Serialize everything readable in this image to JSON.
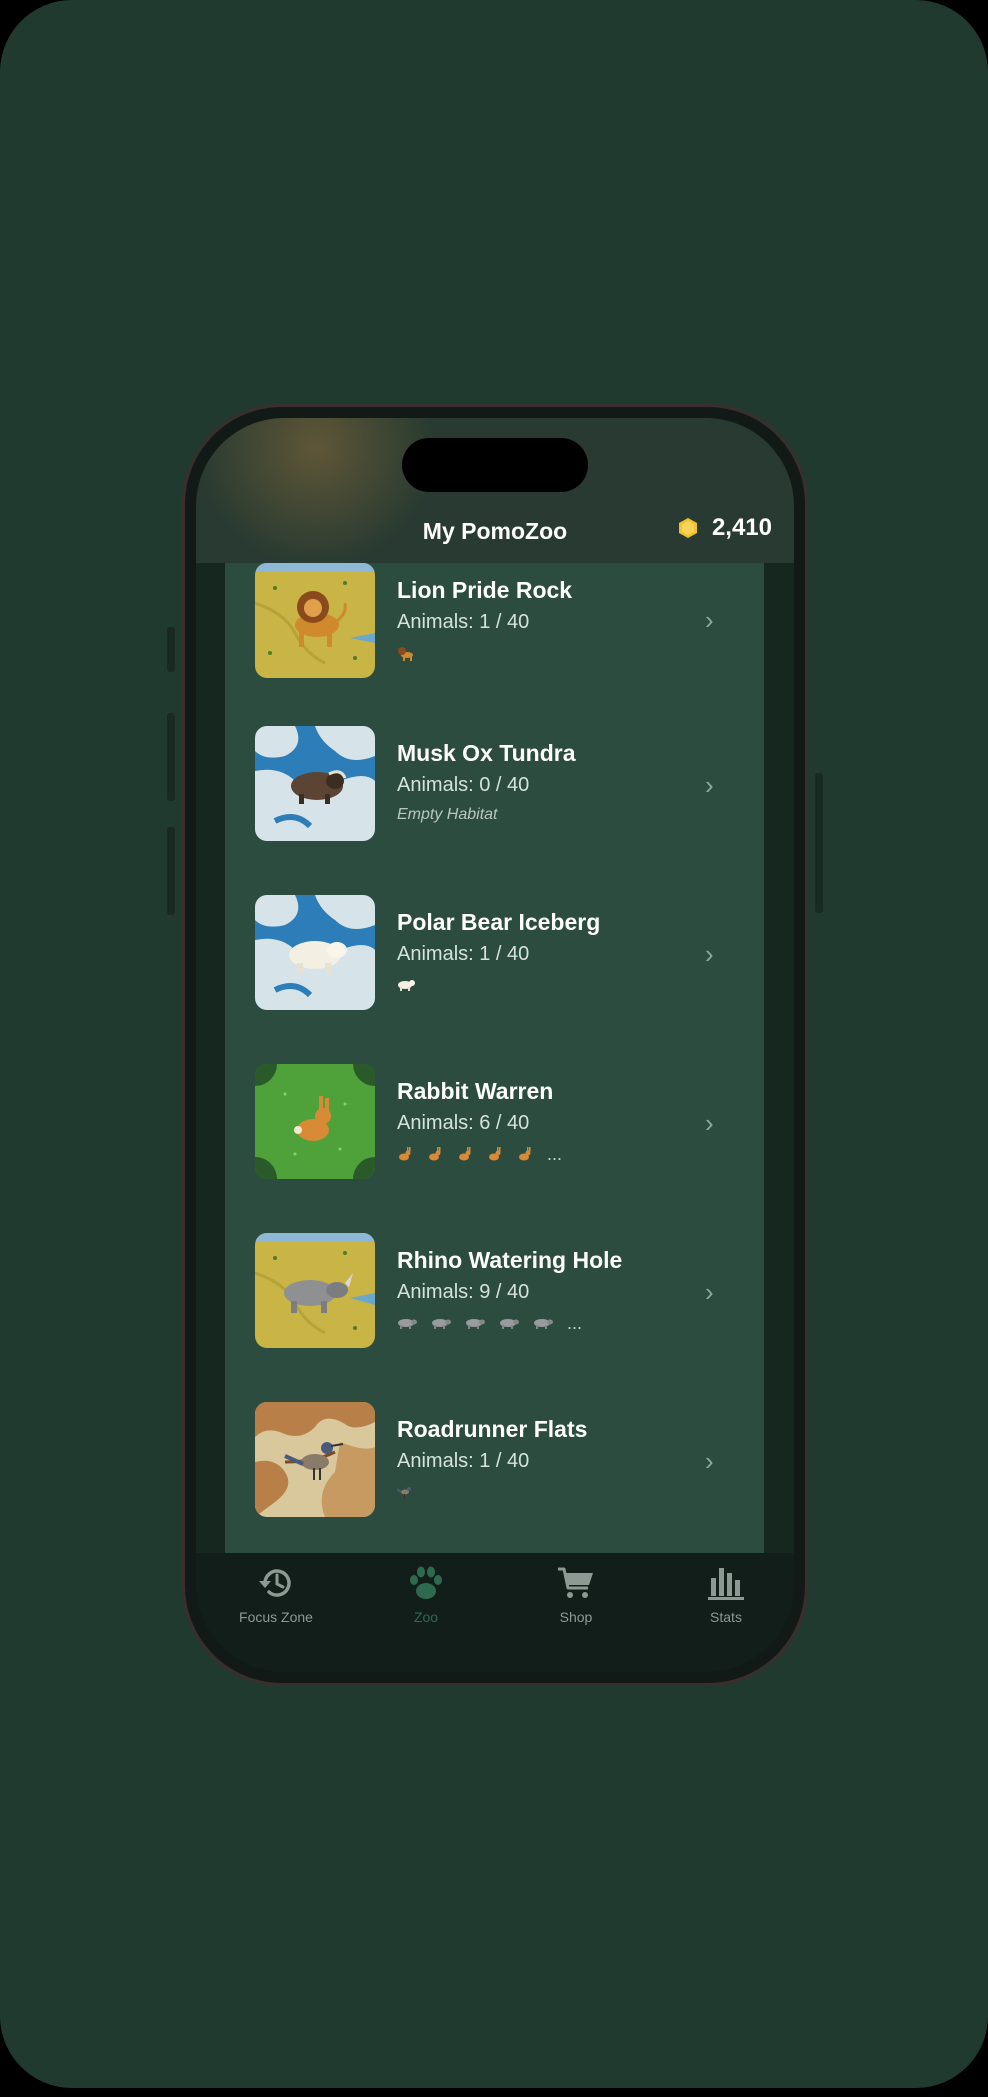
{
  "app": {
    "title": "My PomoZoo",
    "coins": "2,410"
  },
  "habitats": [
    {
      "name": "Lion Pride Rock",
      "animals": "Animals: 1 / 40",
      "icons": 1,
      "more": "",
      "empty_label": "",
      "thumb": "savanna-lion"
    },
    {
      "name": "Musk Ox Tundra",
      "animals": "Animals: 0 / 40",
      "icons": 0,
      "more": "",
      "empty_label": "Empty Habitat",
      "thumb": "tundra-muskox"
    },
    {
      "name": "Polar Bear Iceberg",
      "animals": "Animals: 1 / 40",
      "icons": 1,
      "more": "",
      "empty_label": "",
      "thumb": "ice-polarbear"
    },
    {
      "name": "Rabbit Warren",
      "animals": "Animals: 6 / 40",
      "icons": 5,
      "more": "...",
      "empty_label": "",
      "thumb": "grass-rabbit"
    },
    {
      "name": "Rhino Watering Hole",
      "animals": "Animals: 9 / 40",
      "icons": 5,
      "more": "...",
      "empty_label": "",
      "thumb": "savanna-rhino"
    },
    {
      "name": "Roadrunner Flats",
      "animals": "Animals: 1 / 40",
      "icons": 1,
      "more": "",
      "empty_label": "",
      "thumb": "desert-roadrunner"
    }
  ],
  "tabs": [
    {
      "label": "Focus Zone",
      "icon": "history-icon",
      "active": false
    },
    {
      "label": "Zoo",
      "icon": "paw-icon",
      "active": true
    },
    {
      "label": "Shop",
      "icon": "cart-icon",
      "active": false
    },
    {
      "label": "Stats",
      "icon": "bar-chart-icon",
      "active": false
    }
  ],
  "colors": {
    "background": "#213a30",
    "list_background": "#2b4c3f",
    "coin": "#f2c12e",
    "active_tab": "#2f6a50"
  }
}
